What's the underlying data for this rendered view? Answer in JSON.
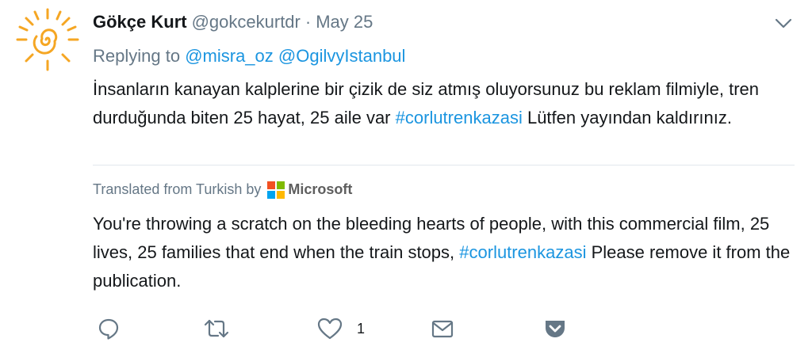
{
  "tweet": {
    "display_name": "Gökçe Kurt",
    "handle": "@gokcekurtdr",
    "separator": "·",
    "date": "May 25",
    "replying_to_label": "Replying to",
    "replying_to": [
      "@misra_oz",
      "@OgilvyIstanbul"
    ],
    "text_before_hashtag": "İnsanların kanayan kalplerine bir çizik de siz atmış oluyorsunuz bu reklam filmiyle, tren durduğunda biten 25 hayat, 25 aile var",
    "hashtag": "#corlutrenkazasi",
    "text_after_hashtag": "Lütfen yayından kaldırınız."
  },
  "translation": {
    "label": "Translated from Turkish by",
    "provider": "Microsoft",
    "text_before_hashtag": "You're throwing a scratch on the bleeding hearts of people, with this commercial film, 25 lives, 25 families that end when the train stops,",
    "hashtag": "#corlutrenkazasi",
    "text_after_hashtag": "Please remove it from the publication."
  },
  "actions": {
    "reply_icon": "reply-icon",
    "retweet_icon": "retweet-icon",
    "like_icon": "heart-icon",
    "like_count": "1",
    "dm_icon": "envelope-icon",
    "pocket_icon": "pocket-icon"
  },
  "colors": {
    "link": "#1b95e0",
    "muted": "#657786",
    "text": "#14171a",
    "divider": "#e1e8ed",
    "avatar_accent": "#f5a623",
    "pocket": "#657786"
  }
}
